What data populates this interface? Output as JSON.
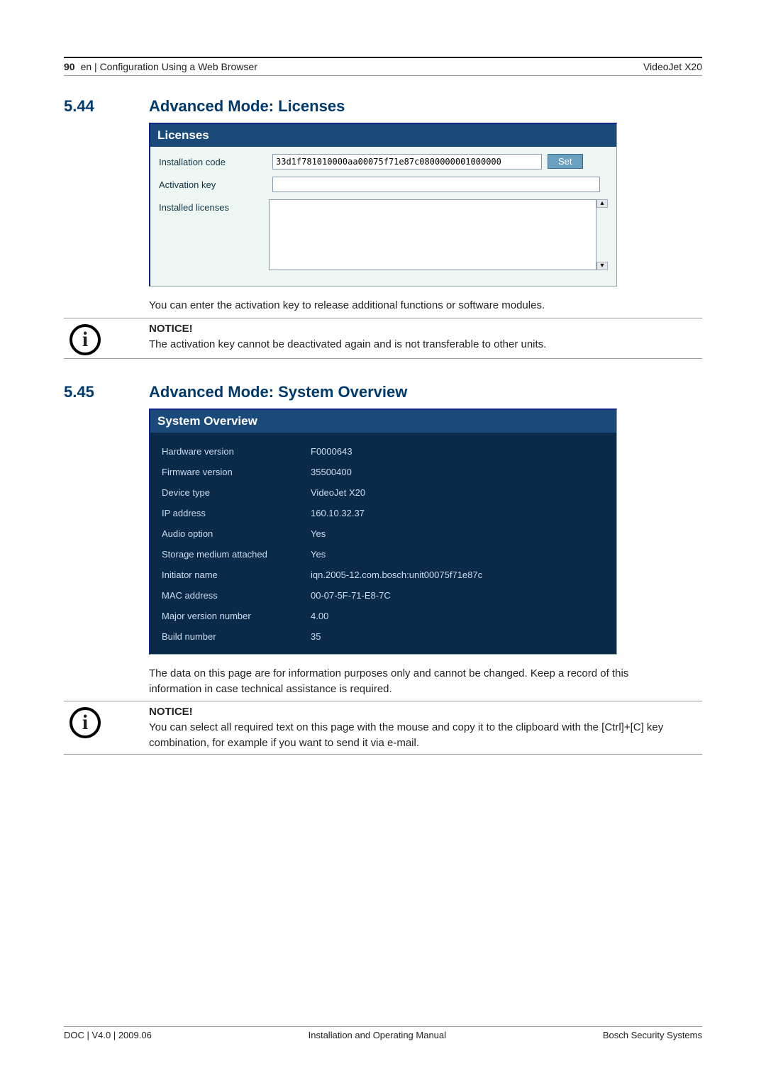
{
  "header": {
    "page_number": "90",
    "breadcrumb": "en | Configuration Using a Web Browser",
    "product": "VideoJet X20"
  },
  "sec1": {
    "number": "5.44",
    "title": "Advanced Mode: Licenses",
    "panel_title": "Licenses",
    "rows": {
      "install_label": "Installation code",
      "install_value": "33d1f781010000aa00075f71e87c0800000001000000",
      "set_btn": "Set",
      "act_label": "Activation key",
      "act_value": "",
      "lic_label": "Installed licenses",
      "lic_value": ""
    },
    "body": "You can enter the activation key to release additional functions or software modules.",
    "notice_head": "NOTICE!",
    "notice_body": "The activation key cannot be deactivated again and is not transferable to other units."
  },
  "sec2": {
    "number": "5.45",
    "title": "Advanced Mode: System Overview",
    "panel_title": "System Overview",
    "rows": [
      {
        "label": "Hardware version",
        "value": "F0000643"
      },
      {
        "label": "Firmware version",
        "value": "35500400"
      },
      {
        "label": "Device type",
        "value": "VideoJet X20"
      },
      {
        "label": "IP address",
        "value": "160.10.32.37"
      },
      {
        "label": "Audio option",
        "value": "Yes"
      },
      {
        "label": "Storage medium attached",
        "value": "Yes"
      },
      {
        "label": "Initiator name",
        "value": "iqn.2005-12.com.bosch:unit00075f71e87c"
      },
      {
        "label": "MAC address",
        "value": "00-07-5F-71-E8-7C"
      },
      {
        "label": "Major version number",
        "value": "4.00"
      },
      {
        "label": "Build number",
        "value": "35"
      }
    ],
    "body": "The data on this page are for information purposes only and cannot be changed. Keep a record of this information in case technical assistance is required.",
    "notice_head": "NOTICE!",
    "notice_body": "You can select all required text on this page with the mouse and copy it to the clipboard with the [Ctrl]+[C] key combination, for example if you want to send it via e-mail."
  },
  "footer": {
    "left": "DOC | V4.0 | 2009.06",
    "center": "Installation and Operating Manual",
    "right": "Bosch Security Systems"
  }
}
